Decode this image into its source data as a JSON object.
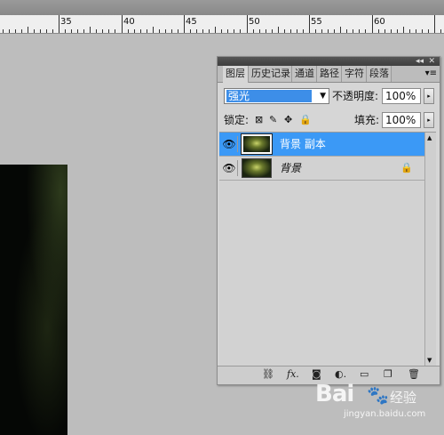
{
  "ruler": {
    "labels": [
      "35",
      "40",
      "45",
      "50",
      "55",
      "60"
    ]
  },
  "panel": {
    "tabs": [
      {
        "label": "图层"
      },
      {
        "label": "历史记录"
      },
      {
        "label": "通道"
      },
      {
        "label": "路径"
      },
      {
        "label": "字符"
      },
      {
        "label": "段落"
      }
    ],
    "blend_mode": "强光",
    "opacity_label": "不透明度:",
    "opacity_value": "100%",
    "lock_label": "锁定:",
    "fill_label": "填充:",
    "fill_value": "100%",
    "layers": [
      {
        "name": "背景 副本",
        "selected": true,
        "visible": true
      },
      {
        "name": "背景",
        "selected": false,
        "visible": true,
        "locked": true
      }
    ]
  },
  "watermark": {
    "brand": "Bai",
    "brand2": "经验",
    "url": "jingyan.baidu.com"
  },
  "colors": {
    "selection": "#3b99f6",
    "blend_highlight": "#3d8ee8",
    "panel_bg": "#d6d6d6",
    "canvas_bg": "#bdbdbd"
  },
  "icons": {
    "layer_visibility": "eye-icon",
    "layer_lock": "lock-icon",
    "footer": [
      "link-icon",
      "fx-icon",
      "mask-icon",
      "adjustment-icon",
      "folder-icon",
      "new-layer-icon",
      "trash-icon"
    ]
  }
}
